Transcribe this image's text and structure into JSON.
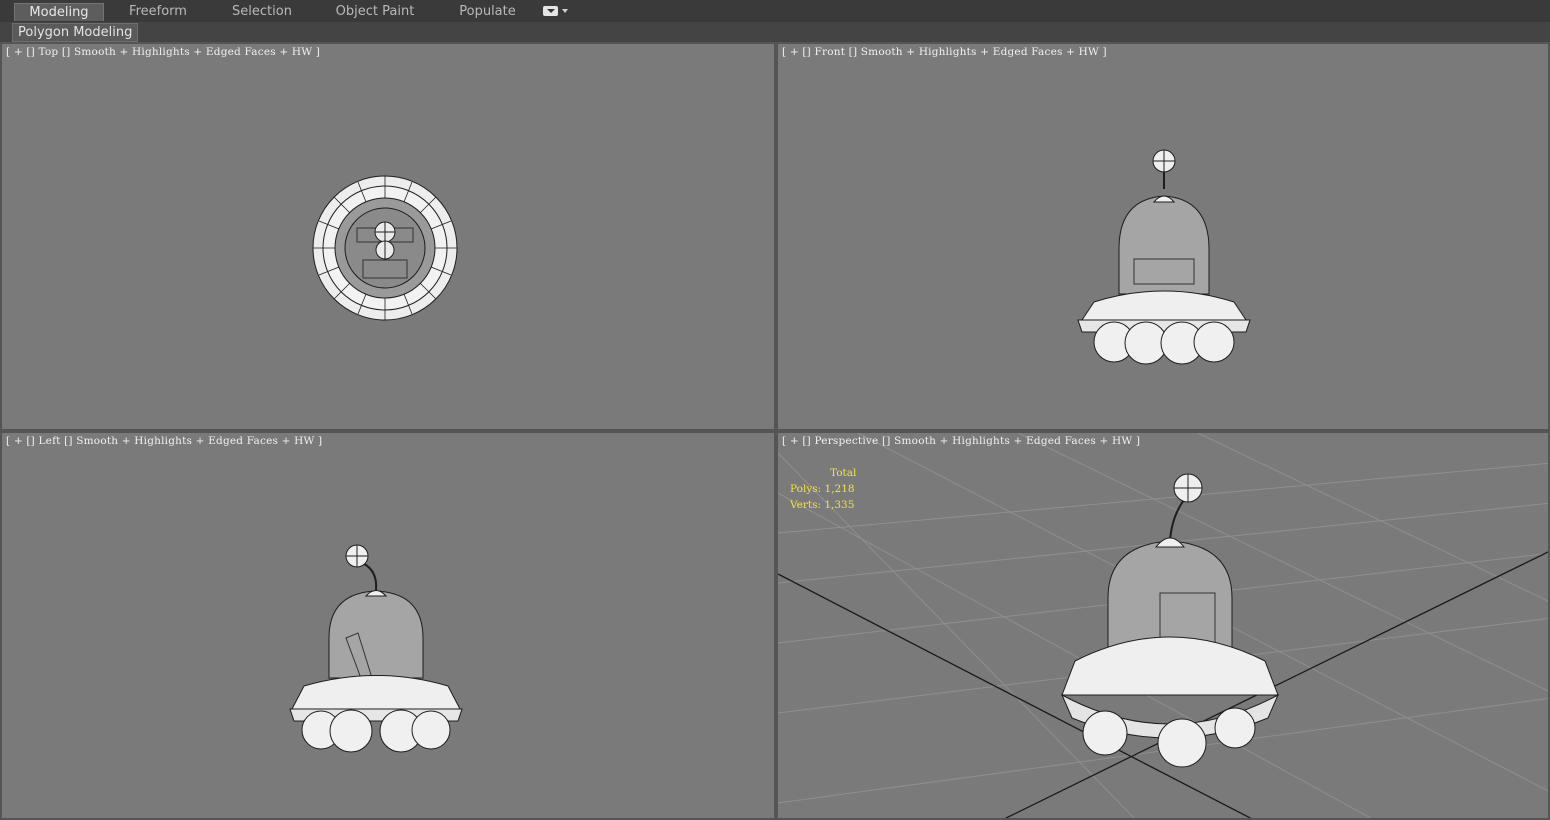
{
  "ribbon": {
    "tabs": [
      {
        "label": "Modeling",
        "active": true
      },
      {
        "label": "Freeform",
        "active": false
      },
      {
        "label": "Selection",
        "active": false
      },
      {
        "label": "Object Paint",
        "active": false
      },
      {
        "label": "Populate",
        "active": false
      }
    ],
    "panel_label": "Polygon Modeling"
  },
  "viewports": {
    "top": {
      "label": "[ + [] Top [] Smooth + Highlights + Edged Faces + HW ]"
    },
    "front": {
      "label": "[ + [] Front [] Smooth + Highlights + Edged Faces + HW ]"
    },
    "left": {
      "label": "[ + [] Left [] Smooth + Highlights + Edged Faces + HW ]"
    },
    "perspective": {
      "label": "[ + [] Perspective [] Smooth + Highlights + Edged Faces + HW ]",
      "stats": {
        "total": "Total",
        "polys": "Polys: 1,218",
        "verts": "Verts: 1,335"
      }
    }
  },
  "colors": {
    "viewport_bg": "#7a7a7a",
    "stats_text": "#f4e23c",
    "label_text": "#f1f1f1"
  }
}
